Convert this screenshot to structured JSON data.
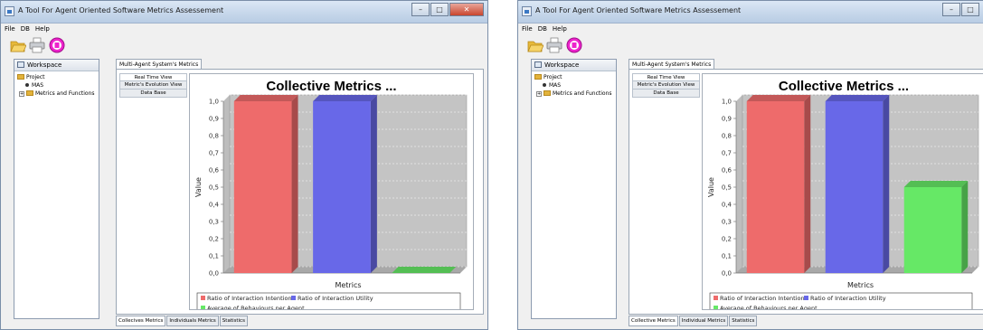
{
  "windows": [
    {
      "title": "A Tool For Agent Oriented Software Metrics Assessement",
      "menu": [
        "File",
        "DB",
        "Help"
      ],
      "workspace": {
        "header": "Workspace",
        "tree": {
          "root": "Project",
          "leaf": "MAS",
          "folder": "Metrics and Functions"
        }
      },
      "main_tab": "Multi-Agent System's Metrics",
      "views": [
        "Real Time View",
        "Metric's Evolution View",
        "Data Base"
      ],
      "bottom_tabs": [
        "Collecives Metrics",
        "Individuals Metrics",
        "Statistics"
      ],
      "chart_data": {
        "type": "bar",
        "title": "Collective Metrics ...",
        "xlabel": "Metrics",
        "ylabel": "Value",
        "ylim": [
          0,
          1.0
        ],
        "yticks": [
          "0,0",
          "0,1",
          "0,2",
          "0,3",
          "0,4",
          "0,5",
          "0,6",
          "0,7",
          "0,8",
          "0,9",
          "1,0"
        ],
        "grid": true,
        "legend_position": "bottom",
        "series": [
          {
            "name": "Ratio of Interaction Intention",
            "value": 1.0,
            "color": "#ee6b6b"
          },
          {
            "name": "Ratio of Interaction Utility",
            "value": 1.0,
            "color": "#6868e8"
          },
          {
            "name": "Average of Behaviours per Agent",
            "value": 0.0,
            "color": "#66e866"
          }
        ]
      }
    },
    {
      "title": "A Tool For Agent Oriented Software Metrics Assessement",
      "menu": [
        "File",
        "DB",
        "Help"
      ],
      "workspace": {
        "header": "Workspace",
        "tree": {
          "root": "Project",
          "leaf": "MAS",
          "folder": "Metrics and Functions"
        }
      },
      "main_tab": "Multi-Agent System's Metrics",
      "views": [
        "Real Time View",
        "Metric's Evolution View",
        "Data Base"
      ],
      "bottom_tabs": [
        "Collective Metrics",
        "Individual Metrics",
        "Statistics"
      ],
      "chart_data": {
        "type": "bar",
        "title": "Collective Metrics ...",
        "xlabel": "Metrics",
        "ylabel": "Value",
        "ylim": [
          0,
          1.0
        ],
        "yticks": [
          "0,0",
          "0,1",
          "0,2",
          "0,3",
          "0,4",
          "0,5",
          "0,6",
          "0,7",
          "0,8",
          "0,9",
          "1,0"
        ],
        "grid": true,
        "legend_position": "bottom",
        "series": [
          {
            "name": "Ratio of Interaction Intention",
            "value": 1.0,
            "color": "#ee6b6b"
          },
          {
            "name": "Ratio of Interaction Utility",
            "value": 1.0,
            "color": "#6868e8"
          },
          {
            "name": "Average of Behaviours per Agent",
            "value": 0.5,
            "color": "#66e866"
          }
        ]
      }
    }
  ]
}
